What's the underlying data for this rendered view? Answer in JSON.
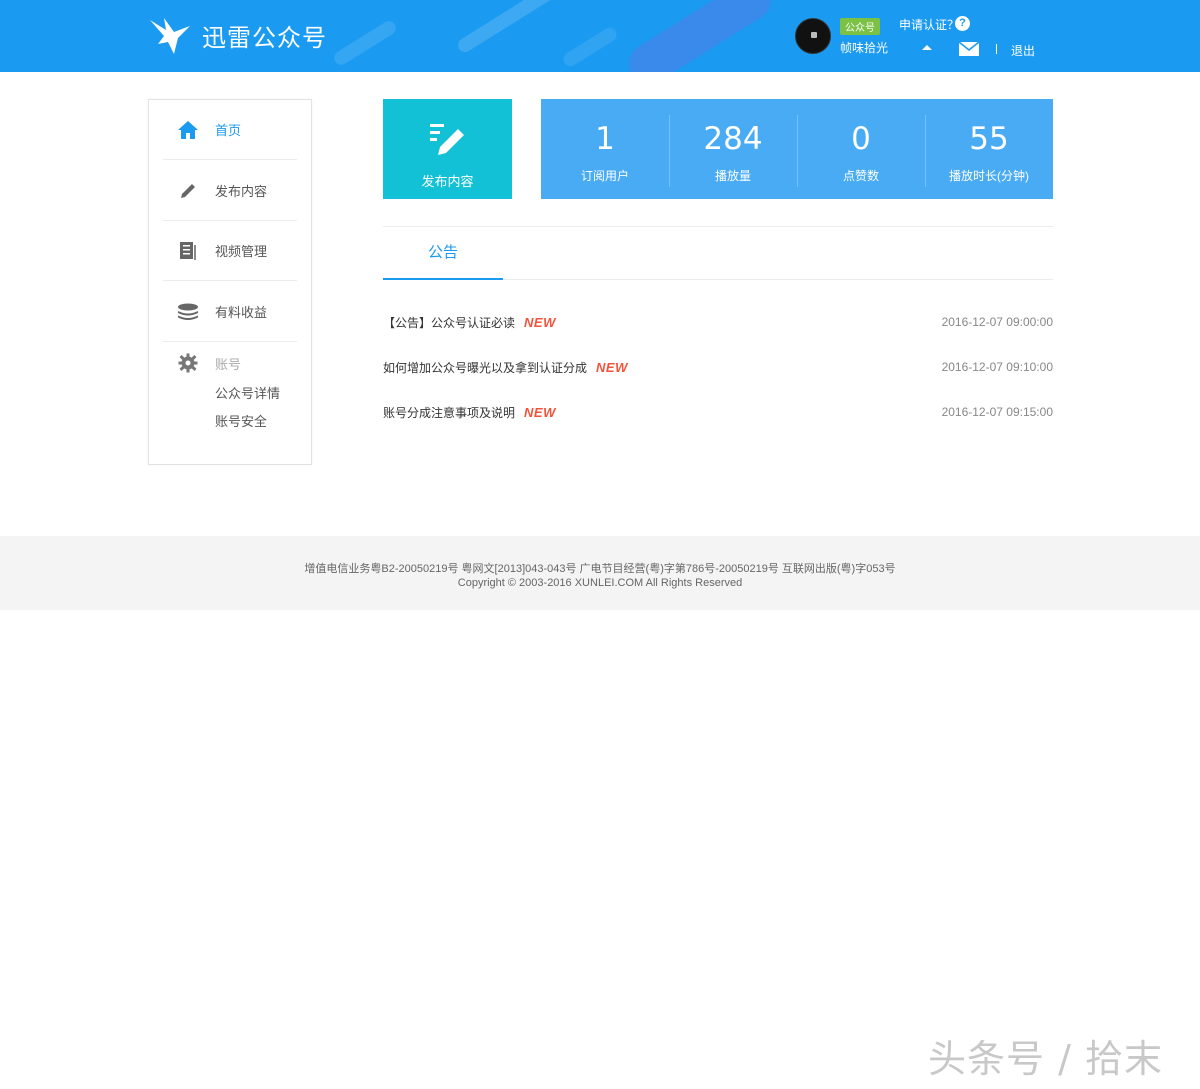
{
  "header": {
    "brand": "迅雷公众号",
    "badge": "公众号",
    "apply_cert": "申请认证？",
    "help": "?",
    "username": "帧味拾光",
    "logout": "退出",
    "background_color": "#1a9af0"
  },
  "sidebar": {
    "items": [
      {
        "label": "首页",
        "icon": "home-icon",
        "active": true
      },
      {
        "label": "发布内容",
        "icon": "pencil-icon"
      },
      {
        "label": "视频管理",
        "icon": "document-icon"
      },
      {
        "label": "有料收益",
        "icon": "coins-icon"
      }
    ],
    "account": {
      "label": "账号",
      "icon": "gear-icon",
      "links": [
        "公众号详情",
        "账号安全"
      ]
    }
  },
  "stats": {
    "publish_label": "发布内容",
    "publish_color": "#13c1d6",
    "panel_color": "#4aabf5",
    "items": [
      {
        "value": "1",
        "label": "订阅用户"
      },
      {
        "value": "284",
        "label": "播放量"
      },
      {
        "value": "0",
        "label": "点赞数"
      },
      {
        "value": "55",
        "label": "播放时长(分钟)"
      }
    ]
  },
  "tabs": [
    {
      "label": "公告",
      "active": true
    }
  ],
  "announcements": [
    {
      "title": "【公告】公众号认证必读",
      "tag": "NEW",
      "date": "2016-12-07 09:00:00"
    },
    {
      "title": "如何增加公众号曝光以及拿到认证分成",
      "tag": "NEW",
      "date": "2016-12-07 09:10:00"
    },
    {
      "title": "账号分成注意事项及说明",
      "tag": "NEW",
      "date": "2016-12-07 09:15:00"
    }
  ],
  "new_tag_color": "#f2553b",
  "footer": {
    "license": "增值电信业务粤B2-20050219号 粤网文[2013]043-043号 广电节目经营(粤)字第786号-20050219号 互联网出版(粤)字053号",
    "copyright": "Copyright © 2003-2016 XUNLEI.COM All Rights Reserved"
  },
  "watermark": "头条号 / 拾末"
}
